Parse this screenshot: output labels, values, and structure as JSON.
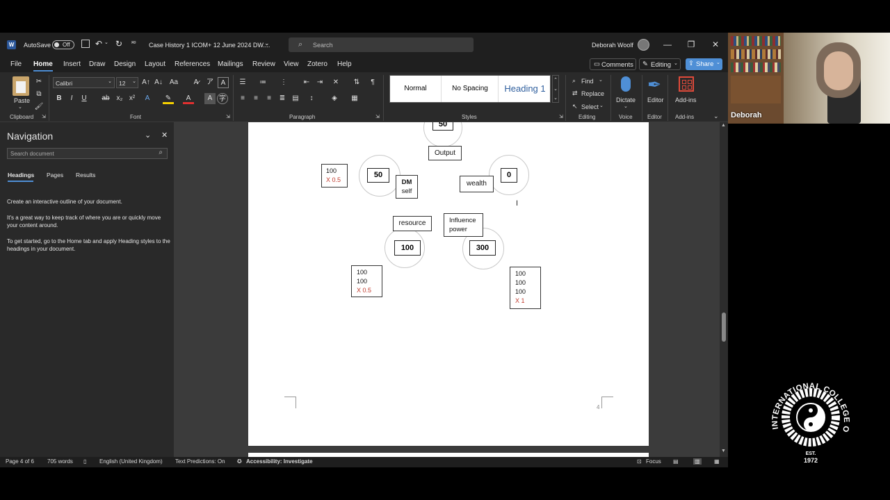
{
  "titlebar": {
    "app_letter": "W",
    "autosave_label": "AutoSave",
    "autosave_state": "Off",
    "doc_title": "Case History 1 ICOM+ 12 June 2024 DW....",
    "search_placeholder": "Search",
    "user_name": "Deborah Woolf"
  },
  "menubar": {
    "tabs": [
      "File",
      "Home",
      "Insert",
      "Draw",
      "Design",
      "Layout",
      "References",
      "Mailings",
      "Review",
      "View",
      "Zotero",
      "Help"
    ],
    "active_tab": "Home",
    "comments_label": "Comments",
    "editing_label": "Editing",
    "share_label": "Share"
  },
  "ribbon": {
    "paste_label": "Paste",
    "font_name": "Calibri",
    "font_size": "12",
    "styles": [
      "Normal",
      "No Spacing",
      "Heading 1"
    ],
    "find_label": "Find",
    "replace_label": "Replace",
    "select_label": "Select",
    "dictate_label": "Dictate",
    "editor_label": "Editor",
    "addins_label": "Add-ins",
    "groups": {
      "clipboard": "Clipboard",
      "font": "Font",
      "paragraph": "Paragraph",
      "styles": "Styles",
      "editing": "Editing",
      "voice": "Voice",
      "editor": "Editor",
      "addins": "Add-ins"
    }
  },
  "nav": {
    "title": "Navigation",
    "search_placeholder": "Search document",
    "tabs": [
      "Headings",
      "Pages",
      "Results"
    ],
    "active_tab": "Headings",
    "p1": "Create an interactive outline of your document.",
    "p2": "It's a great way to keep track of where you are or quickly move your content around.",
    "p3": "To get started, go to the Home tab and apply Heading styles to the headings in your document."
  },
  "diagram": {
    "top_number": "50",
    "output_label": "Output",
    "dm_number": "50",
    "dm_label_1": "DM",
    "dm_label_2": "self",
    "dm_side_1": "100",
    "dm_side_2": "X 0.5",
    "wealth_label": "wealth",
    "wealth_number": "0",
    "resource_label": "resource",
    "resource_number": "100",
    "resource_side": [
      "100",
      "100",
      "X 0.5"
    ],
    "influence_label_1": "Influence",
    "influence_label_2": "power",
    "influence_number": "300",
    "influence_side": [
      "100",
      "100",
      "100",
      "X 1"
    ],
    "page_number": "4"
  },
  "statusbar": {
    "page": "Page 4 of 6",
    "words": "705 words",
    "language": "English (United Kingdom)",
    "predictions": "Text Predictions: On",
    "accessibility": "Accessibility: Investigate",
    "focus": "Focus"
  },
  "video": {
    "participant_name": "Deborah"
  },
  "logo": {
    "text": "INTERNATIONAL COLLEGE OF ORIENTAL MEDICINE",
    "est": "EST.",
    "year": "1972"
  },
  "colors": {
    "accent": "#4f8fd6",
    "red_note": "#c0392b"
  }
}
